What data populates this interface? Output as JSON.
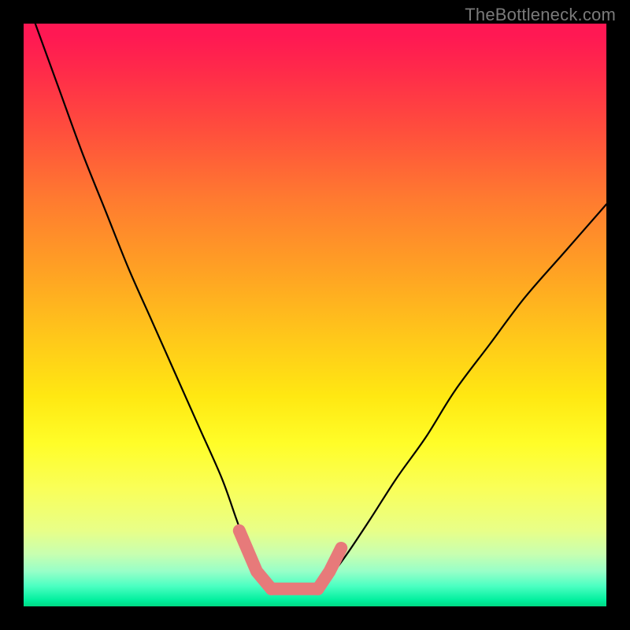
{
  "watermark": {
    "text": "TheBottleneck.com"
  },
  "colors": {
    "background": "#000000",
    "curve_stroke": "#000000",
    "segment_stroke": "#e77a7a",
    "gradient_top": "#ff1853",
    "gradient_mid": "#ffe812",
    "gradient_bottom": "#00d884"
  },
  "chart_data": {
    "type": "line",
    "title": "",
    "xlabel": "",
    "ylabel": "",
    "xlim": [
      0,
      100
    ],
    "ylim": [
      0,
      100
    ],
    "grid": false,
    "legend": false,
    "series": [
      {
        "name": "left_curve",
        "x": [
          2,
          6,
          10,
          14,
          18,
          22,
          26,
          30,
          34,
          36.5,
          38.5,
          40.5,
          42.5
        ],
        "values": [
          100,
          89,
          78,
          68,
          58,
          49,
          40,
          31,
          22,
          15,
          9.5,
          5,
          3
        ]
      },
      {
        "name": "right_curve",
        "x": [
          50.5,
          52.5,
          55.5,
          59.5,
          64,
          69,
          74,
          80,
          86,
          93,
          100
        ],
        "values": [
          3,
          5,
          9,
          15,
          22,
          29,
          37,
          45,
          53,
          61,
          69
        ]
      },
      {
        "name": "bottom_flat",
        "x": [
          42.5,
          50.5
        ],
        "values": [
          3,
          3
        ]
      },
      {
        "name": "highlight_left",
        "x": [
          37,
          40,
          42.5
        ],
        "values": [
          13,
          6,
          3
        ]
      },
      {
        "name": "highlight_bottom",
        "x": [
          42.5,
          50.5
        ],
        "values": [
          3,
          3
        ]
      },
      {
        "name": "highlight_right",
        "x": [
          50.5,
          52.5,
          54.5
        ],
        "values": [
          3,
          6,
          10
        ]
      }
    ]
  }
}
